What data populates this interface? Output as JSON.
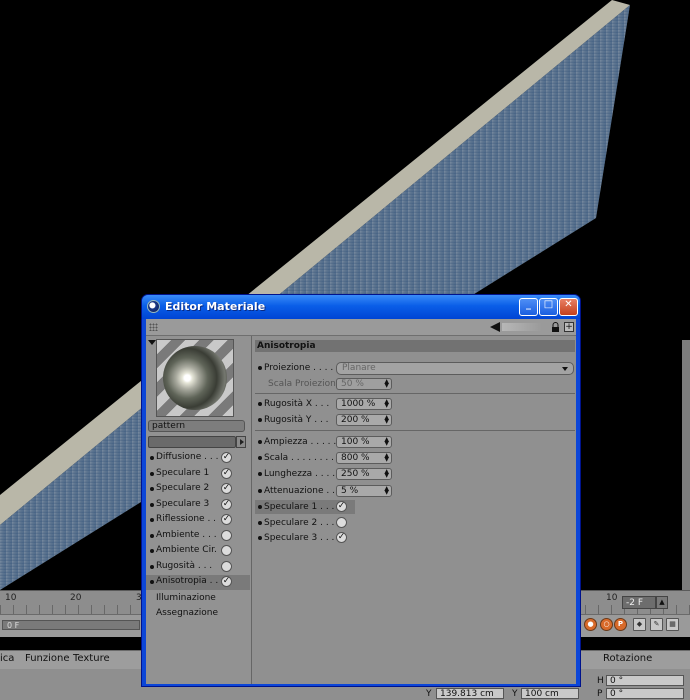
{
  "window": {
    "title": "Editor Materiale"
  },
  "colors": {
    "titlebar": "#0a5ee8",
    "panel": "#909090",
    "accent_orange": "#d86a2a"
  },
  "icons": [
    "app-icon",
    "minimize-icon",
    "maximize-icon",
    "close-icon",
    "grip-icon",
    "back-arrow-icon",
    "lock-icon",
    "expand-icon",
    "checkmark-icon"
  ],
  "material": {
    "name": "pattern",
    "channels": [
      {
        "label": "Diffusione . . .",
        "checked": true
      },
      {
        "label": "Speculare 1",
        "checked": true
      },
      {
        "label": "Speculare 2",
        "checked": true
      },
      {
        "label": "Speculare 3",
        "checked": true
      },
      {
        "label": "Riflessione . .",
        "checked": true
      },
      {
        "label": "Ambiente . . .",
        "checked": false
      },
      {
        "label": "Ambiente Cir.",
        "checked": false
      },
      {
        "label": "Rugosità . . .",
        "checked": false
      },
      {
        "label": "Anisotropia . .",
        "checked": true,
        "active": true
      }
    ],
    "extra_items": [
      "Illuminazione",
      "Assegnazione"
    ]
  },
  "section": {
    "title": "Anisotropia",
    "proiezione": {
      "label": "Proiezione . . . .",
      "value": "Planare"
    },
    "scala_proiezione": {
      "label": "Scala Proiezione",
      "value": "50 %"
    },
    "rugosita_x": {
      "label": "Rugosità X . . .",
      "value": "1000 %"
    },
    "rugosita_y": {
      "label": "Rugosità Y . . .",
      "value": "200 %"
    },
    "ampiezza": {
      "label": "Ampiezza . . . . .",
      "value": "100 %"
    },
    "scala": {
      "label": "Scala . . . . . . . .",
      "value": "800 %"
    },
    "lunghezza": {
      "label": "Lunghezza . . . .",
      "value": "250 %"
    },
    "attenuazione": {
      "label": "Attenuazione . .",
      "value": "5 %"
    },
    "speculari": [
      {
        "label": "Speculare 1 . . .",
        "checked": true
      },
      {
        "label": "Speculare 2 . . .",
        "checked": false
      },
      {
        "label": "Speculare 3 . . .",
        "checked": true
      }
    ]
  },
  "timeline": {
    "ticks": [
      "10",
      "20",
      "3",
      "10"
    ],
    "frame_field": "-2 F",
    "slider_value": "0 F"
  },
  "menu": {
    "items": [
      "ica",
      "Funzione",
      "Texture"
    ],
    "right_label": "Rotazione"
  },
  "coords": {
    "y_label": "Y",
    "y_value": "139.813 cm",
    "y2_label": "Y",
    "y2_value": "100 cm",
    "p_label": "P",
    "p_value": "0 °",
    "h_label": "H",
    "h_value": "0 °"
  }
}
